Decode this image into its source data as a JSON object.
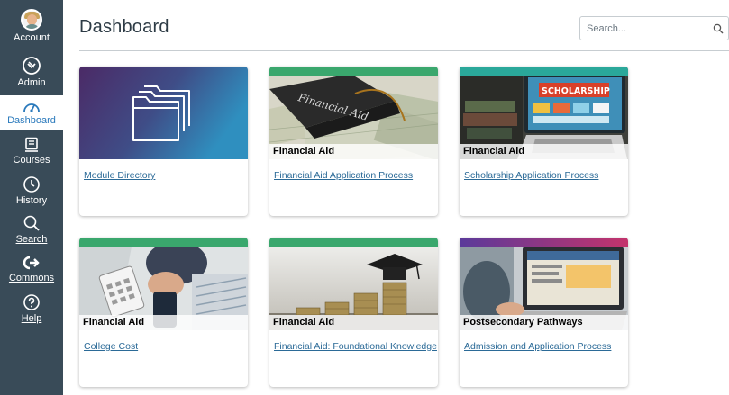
{
  "nav": {
    "account": "Account",
    "admin": "Admin",
    "dashboard": "Dashboard",
    "courses": "Courses",
    "history": "History",
    "search": "Search",
    "commons": "Commons",
    "help": "Help"
  },
  "header": {
    "title": "Dashboard",
    "search_placeholder": "Search..."
  },
  "cards": [
    {
      "caption": "",
      "link": "Module Directory",
      "accent": "#4a2f6b"
    },
    {
      "caption": "Financial Aid",
      "link": "Financial Aid Application Process",
      "accent": "#3aa76d",
      "hero_text": "Financial Aid"
    },
    {
      "caption": "Financial Aid",
      "link": "Scholarship Application Process",
      "accent": "#2aa89a",
      "hero_text": "SCHOLARSHIP"
    },
    {
      "caption": "Financial Aid",
      "link": "College Cost",
      "accent": "#3aa76d"
    },
    {
      "caption": "Financial Aid",
      "link": "Financial Aid: Foundational Knowledge",
      "accent": "#3aa76d"
    },
    {
      "caption": "Postsecondary Pathways",
      "link": "Admission and Application Process",
      "accent": "#8a3c9a"
    }
  ]
}
